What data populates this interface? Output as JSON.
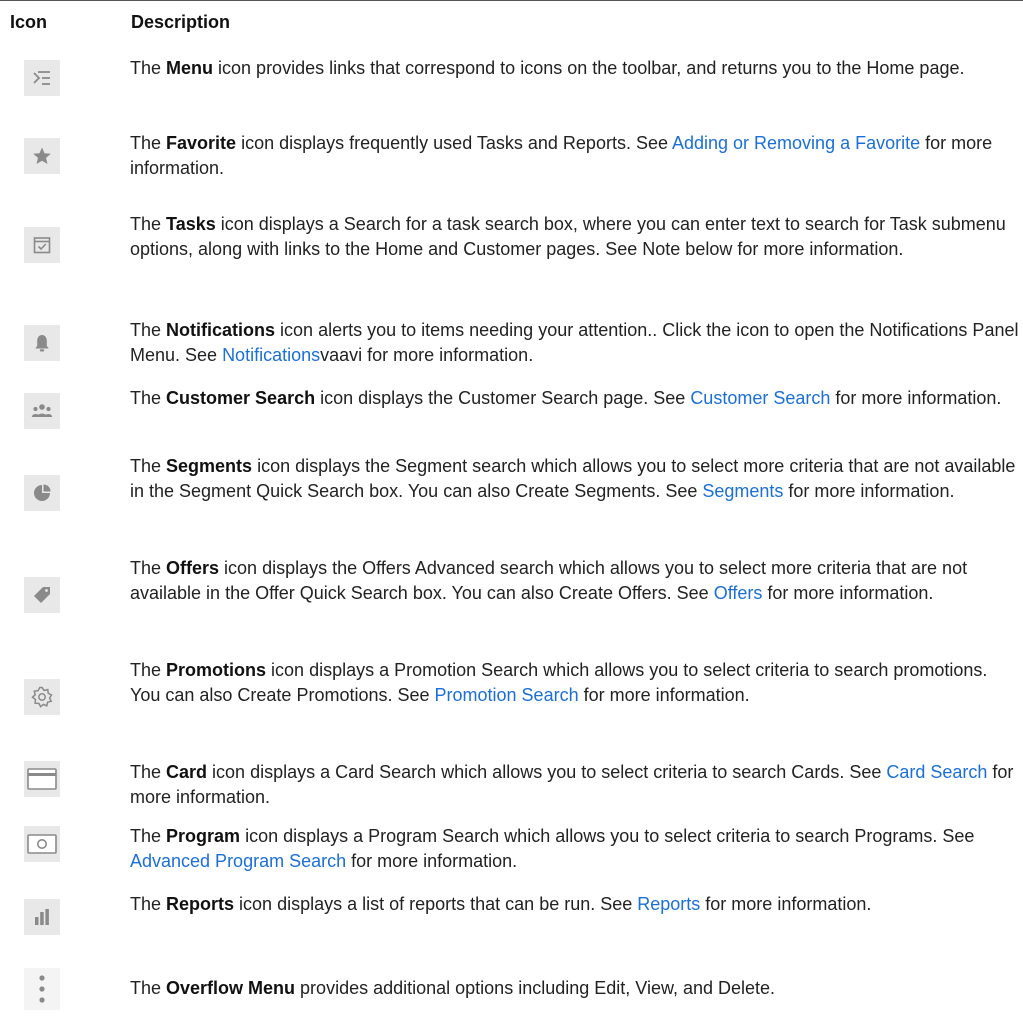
{
  "table": {
    "headers": {
      "icon": "Icon",
      "description": "Description"
    },
    "rows": [
      {
        "icon_name": "menu-icon",
        "pre": "The ",
        "bold": "Menu",
        "post": " icon provides links that correspond to icons on the toolbar, and returns you to the Home page.",
        "link": "",
        "after": ""
      },
      {
        "icon_name": "star-icon",
        "pre": "The ",
        "bold": "Favorite",
        "post": " icon displays frequently used Tasks and Reports. See ",
        "link": "Adding or Removing a Favorite",
        "after": " for more information."
      },
      {
        "icon_name": "calendar-check-icon",
        "pre": "The ",
        "bold": "Tasks",
        "post": " icon displays a Search for a task search box, where you can enter text to search for Task submenu options, along with links to the Home and Customer pages. See Note below for more information.",
        "link": "",
        "after": ""
      },
      {
        "icon_name": "bell-icon",
        "pre": "The ",
        "bold": "Notifications",
        "post": " icon alerts you to items needing your attention.. Click the icon to open the Notifications Panel Menu. See ",
        "link": "Notifications",
        "after": "vaavi for more information."
      },
      {
        "icon_name": "people-icon",
        "pre": "The ",
        "bold": "Customer Search",
        "post": " icon displays the Customer Search page. See ",
        "link": "Customer Search",
        "after": " for more information."
      },
      {
        "icon_name": "pie-chart-icon",
        "pre": "The ",
        "bold": "Segments",
        "post": " icon displays the Segment search which allows you to select more criteria that are not available in the Segment Quick Search box. You can also Create Segments. See ",
        "link": "Segments",
        "after": " for more information."
      },
      {
        "icon_name": "tag-icon",
        "pre": "The ",
        "bold": "Offers",
        "post": " icon displays the Offers Advanced search which allows you to select more criteria that are not available in the Offer Quick Search box. You can also Create Offers. See ",
        "link": "Offers",
        "after": " for more information."
      },
      {
        "icon_name": "badge-gear-icon",
        "pre": "The ",
        "bold": "Promotions",
        "post": " icon displays a Promotion Search which allows you to select criteria to search promotions. You can also Create Promotions. See ",
        "link": "Promotion Search",
        "after": " for more information."
      },
      {
        "icon_name": "card-icon",
        "pre": "The ",
        "bold": "Card",
        "post": " icon displays a Card Search which allows you to select criteria to search Cards. See ",
        "link": "Card Search",
        "after": " for more information."
      },
      {
        "icon_name": "program-icon",
        "pre": "The ",
        "bold": "Program",
        "post": " icon displays a Program Search which allows you to select criteria to search Programs. See ",
        "link": "Advanced Program Search",
        "after": " for more information."
      },
      {
        "icon_name": "bar-chart-icon",
        "pre": "The ",
        "bold": "Reports",
        "post": " icon displays a list of reports that can be run. See ",
        "link": "Reports",
        "after": " for more information."
      },
      {
        "icon_name": "overflow-menu-icon",
        "pre": "The ",
        "bold": "Overflow Menu",
        "post": " provides additional options including Edit, View, and Delete.",
        "link": "",
        "after": ""
      }
    ]
  }
}
